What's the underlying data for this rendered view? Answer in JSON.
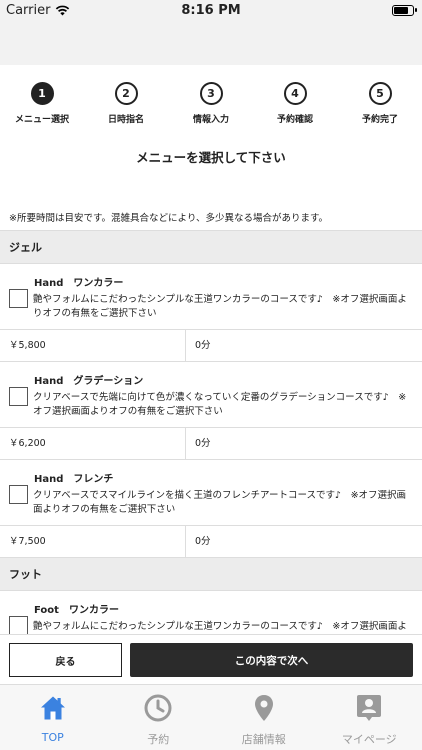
{
  "status_bar": {
    "carrier": "Carrier",
    "time": "8:16 PM"
  },
  "steps": [
    {
      "number": "1",
      "label": "メニュー選択",
      "active": true
    },
    {
      "number": "2",
      "label": "日時指名",
      "active": false
    },
    {
      "number": "3",
      "label": "情報入力",
      "active": false
    },
    {
      "number": "4",
      "label": "予約確認",
      "active": false
    },
    {
      "number": "5",
      "label": "予約完了",
      "active": false
    }
  ],
  "page_title": "メニューを選択して下さい",
  "notice": "※所要時間は目安です。混雑具合などにより、多少異なる場合があります。",
  "sections": [
    {
      "name": "ジェル",
      "items": [
        {
          "title": "Hand　ワンカラー",
          "description": "艶やフォルムにこだわったシンプルな王道ワンカラーのコースです♪　※オフ選択画面よりオフの有無をご選択下さい",
          "price": "￥5,800",
          "duration": "0分"
        },
        {
          "title": "Hand　グラデーション",
          "description": "クリアベースで先端に向けて色が濃くなっていく定番のグラデーションコースです♪　※オフ選択画面よりオフの有無をご選択下さい",
          "price": "￥6,200",
          "duration": "0分"
        },
        {
          "title": "Hand　フレンチ",
          "description": "クリアベースでスマイルラインを描く王道のフレンチアートコースです♪　※オフ選択画面よりオフの有無をご選択下さい",
          "price": "￥7,500",
          "duration": "0分"
        }
      ]
    },
    {
      "name": "フット",
      "items": [
        {
          "title": "Foot　ワンカラー",
          "description": "艶やフォルムにこだわったシンプルな王道ワンカラーのコースです♪　※オフ選択画面よりオフの有無をご選択下さい",
          "price": "",
          "duration": ""
        }
      ]
    }
  ],
  "actions": {
    "back_label": "戻る",
    "next_label": "この内容で次へ"
  },
  "tabs": [
    {
      "label": "TOP",
      "icon": "home-icon",
      "active": true
    },
    {
      "label": "予約",
      "icon": "clock-icon",
      "active": false
    },
    {
      "label": "店舗情報",
      "icon": "location-pin-icon",
      "active": false
    },
    {
      "label": "マイページ",
      "icon": "profile-card-icon",
      "active": false
    }
  ],
  "colors": {
    "accent": "#3b82e0",
    "inactive_icon": "#9a9a9a",
    "button_dark": "#2b2b2b",
    "section_bg": "#ececec"
  }
}
